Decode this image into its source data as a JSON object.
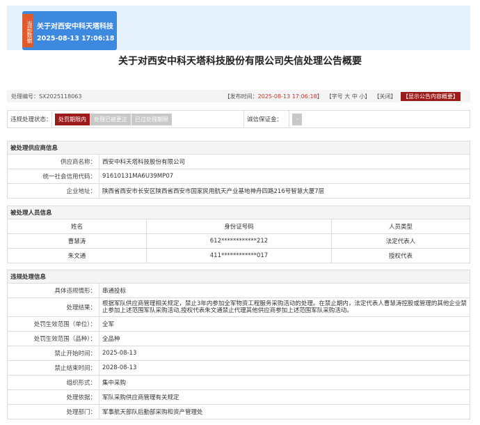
{
  "banner": {
    "badge_text": "当前数据",
    "title": "关于对西安中科天塔科技",
    "time": "2025-08-13 17:06:18"
  },
  "page_title": "关于对西安中科天塔科技股份有限公司失信处理公告概要",
  "meta": {
    "doc_no_label": "处理编号：",
    "doc_no": "SX2025118063",
    "publish_label": "【发布时间：",
    "publish_time": "2025-08-13 17:06:18",
    "publish_suffix": "】",
    "font_label": "【字号",
    "font_big": "大",
    "font_mid": "中",
    "font_small": "小",
    "font_close": "】",
    "close_label": "【关闭】",
    "show_content_button": "【显示公告内容概要】"
  },
  "status": {
    "label": "违规处理状态：",
    "options": [
      "处罚期限内",
      "处理已被更正",
      "已过处理期限"
    ],
    "deposit_label": "诚信保证金：",
    "deposit_value": "-"
  },
  "supplier": {
    "section_title": "被处理供应商信息",
    "rows": [
      {
        "label": "供应商名称：",
        "value": "西安中科天塔科技股份有限公司"
      },
      {
        "label": "统一社会信用代码：",
        "value": "91610131MA6U39MP07"
      },
      {
        "label": "企业地址：",
        "value": "陕西省西安市长安区陕西省西安市国家民用航天产业基地神舟四路216号智慧大厦7层"
      }
    ]
  },
  "persons": {
    "section_title": "被处理人员信息",
    "columns": [
      "姓名",
      "身份证号码",
      "人员类型"
    ],
    "rows": [
      [
        "曹慧涛",
        "612************212",
        "法定代表人"
      ],
      [
        "朱文通",
        "411************017",
        "授权代表"
      ]
    ]
  },
  "violation": {
    "section_title": "违规处理信息",
    "rows": [
      {
        "label": "具体违规情形：",
        "value": "串通投标"
      },
      {
        "label": "处理结果：",
        "value": "根据军队供应商管理相关规定，禁止3年内参加全军物资工程服务采购活动的处理。在禁止期内，法定代表人曹慧涛控股或管理的其他企业禁止参加上述范围军队采购活动,授权代表朱文通禁止代理其他供应商参加上述范围军队采购活动。"
      },
      {
        "label": "处罚生效范围（单位）：",
        "value": "全军"
      },
      {
        "label": "处罚生效范围（品种）：",
        "value": "全品种"
      },
      {
        "label": "禁止开始时间：",
        "value": "2025-08-13"
      },
      {
        "label": "禁止结束时间：",
        "value": "2028-08-13"
      },
      {
        "label": "组织形式：",
        "value": "集中采购"
      },
      {
        "label": "处理依据：",
        "value": "军队采购供应商管理有关规定"
      },
      {
        "label": "处理部门：",
        "value": "军事航天部队后勤部采购和资产管理处"
      }
    ]
  }
}
